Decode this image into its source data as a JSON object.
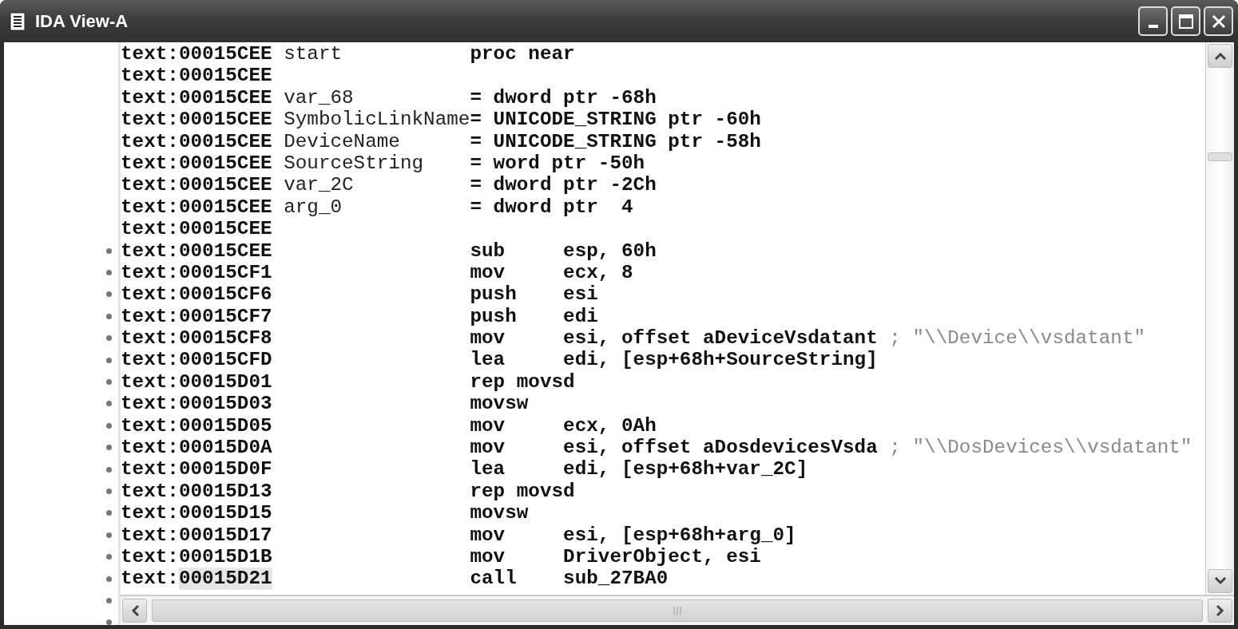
{
  "window": {
    "title": "IDA View-A"
  },
  "lines": [
    {
      "segment": "text:",
      "offset": "00015CEE",
      "label": "start",
      "definition": "proc near",
      "dot": false,
      "highlighted": false
    },
    {
      "segment": "text:",
      "offset": "00015CEE",
      "dot": false,
      "highlighted": false
    },
    {
      "segment": "text:",
      "offset": "00015CEE",
      "label": "var_68",
      "definition": "= dword ptr -68h",
      "dot": false,
      "highlighted": false
    },
    {
      "segment": "text:",
      "offset": "00015CEE",
      "label": "SymbolicLinkName",
      "definition": "= UNICODE_STRING ptr -60h",
      "dot": false,
      "highlighted": false
    },
    {
      "segment": "text:",
      "offset": "00015CEE",
      "label": "DeviceName",
      "definition": "= UNICODE_STRING ptr -58h",
      "dot": false,
      "highlighted": false
    },
    {
      "segment": "text:",
      "offset": "00015CEE",
      "label": "SourceString",
      "definition": "= word ptr -50h",
      "dot": false,
      "highlighted": false
    },
    {
      "segment": "text:",
      "offset": "00015CEE",
      "label": "var_2C",
      "definition": "= dword ptr -2Ch",
      "dot": false,
      "highlighted": false
    },
    {
      "segment": "text:",
      "offset": "00015CEE",
      "label": "arg_0",
      "definition": "= dword ptr  4",
      "dot": false,
      "highlighted": false
    },
    {
      "segment": "text:",
      "offset": "00015CEE",
      "dot": false,
      "highlighted": false
    },
    {
      "segment": "text:",
      "offset": "00015CEE",
      "mnemonic": "sub",
      "operands": "esp, 60h",
      "dot": true,
      "highlighted": false
    },
    {
      "segment": "text:",
      "offset": "00015CF1",
      "mnemonic": "mov",
      "operands": "ecx, 8",
      "dot": true,
      "highlighted": false
    },
    {
      "segment": "text:",
      "offset": "00015CF6",
      "mnemonic": "push",
      "operands": "esi",
      "dot": true,
      "highlighted": false
    },
    {
      "segment": "text:",
      "offset": "00015CF7",
      "mnemonic": "push",
      "operands": "edi",
      "dot": true,
      "highlighted": false
    },
    {
      "segment": "text:",
      "offset": "00015CF8",
      "mnemonic": "mov",
      "operands": "esi, offset aDeviceVsdatant",
      "comment": "; \"\\\\Device\\\\vsdatant\"",
      "dot": true,
      "highlighted": false
    },
    {
      "segment": "text:",
      "offset": "00015CFD",
      "mnemonic": "lea",
      "operands": "edi, [esp+68h+SourceString]",
      "dot": true,
      "highlighted": false
    },
    {
      "segment": "text:",
      "offset": "00015D01",
      "mnemonic": "rep movsd",
      "dot": true,
      "highlighted": false
    },
    {
      "segment": "text:",
      "offset": "00015D03",
      "mnemonic": "movsw",
      "dot": true,
      "highlighted": false
    },
    {
      "segment": "text:",
      "offset": "00015D05",
      "mnemonic": "mov",
      "operands": "ecx, 0Ah",
      "dot": true,
      "highlighted": false
    },
    {
      "segment": "text:",
      "offset": "00015D0A",
      "mnemonic": "mov",
      "operands": "esi, offset aDosdevicesVsda",
      "comment": "; \"\\\\DosDevices\\\\vsdatant\"",
      "dot": true,
      "highlighted": false
    },
    {
      "segment": "text:",
      "offset": "00015D0F",
      "mnemonic": "lea",
      "operands": "edi, [esp+68h+var_2C]",
      "dot": true,
      "highlighted": false
    },
    {
      "segment": "text:",
      "offset": "00015D13",
      "mnemonic": "rep movsd",
      "dot": true,
      "highlighted": false
    },
    {
      "segment": "text:",
      "offset": "00015D15",
      "mnemonic": "movsw",
      "dot": true,
      "highlighted": false
    },
    {
      "segment": "text:",
      "offset": "00015D17",
      "mnemonic": "mov",
      "operands": "esi, [esp+68h+arg_0]",
      "dot": true,
      "highlighted": false
    },
    {
      "segment": "text:",
      "offset": "00015D1B",
      "mnemonic": "mov",
      "operands": "DriverObject, esi",
      "dot": true,
      "highlighted": false
    },
    {
      "segment": "text:",
      "offset": "00015D21",
      "mnemonic": "call",
      "operands": "sub_27BA0",
      "dot": true,
      "highlighted": true
    }
  ],
  "trailing_rows": [
    {
      "dot": true
    },
    {
      "dot": true
    }
  ]
}
